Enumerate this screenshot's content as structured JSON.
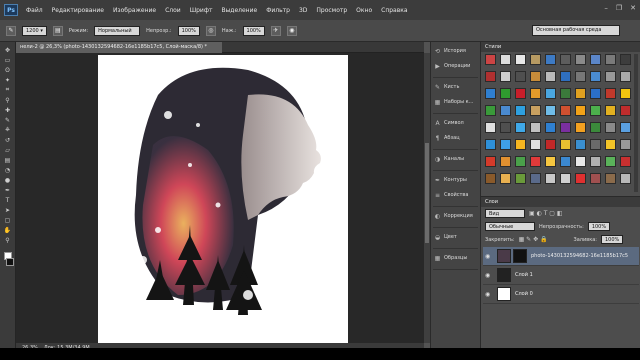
{
  "menubar": {
    "logo": "Ps",
    "items": [
      "Файл",
      "Редактирование",
      "Изображение",
      "Слои",
      "Шрифт",
      "Выделение",
      "Фильтр",
      "3D",
      "Просмотр",
      "Окно",
      "Справка"
    ],
    "window_controls": [
      "–",
      "❐",
      "✕"
    ]
  },
  "options": {
    "brush_size": "1200",
    "mode_label": "Режим:",
    "mode_value": "Нормальный",
    "opacity_label": "Непрозр.:",
    "opacity_value": "100%",
    "flow_label": "Наж.:",
    "flow_value": "100%",
    "workspace": "Основная рабочая среда"
  },
  "document": {
    "tab_title": "нели-2 @ 26,3% (photo-1430132594682-16e1185b17c5, Слой-маска/8) *",
    "zoom": "26,3%",
    "doc_size": "Док: 15,3M/34,9M"
  },
  "panel_column": {
    "groups": [
      [
        {
          "label": "История",
          "icon": "history-icon"
        },
        {
          "label": "Операции",
          "icon": "play-icon"
        }
      ],
      [
        {
          "label": "Кисть",
          "icon": "brush-icon"
        },
        {
          "label": "Наборы к...",
          "icon": "brush-presets-icon"
        }
      ],
      [
        {
          "label": "Символ",
          "icon": "character-icon"
        },
        {
          "label": "Абзац",
          "icon": "paragraph-icon"
        }
      ],
      [
        {
          "label": "Каналы",
          "icon": "channels-icon"
        }
      ],
      [
        {
          "label": "Контуры",
          "icon": "paths-icon"
        },
        {
          "label": "Свойства",
          "icon": "properties-icon"
        }
      ],
      [
        {
          "label": "Коррекция",
          "icon": "adjustments-icon"
        }
      ],
      [
        {
          "label": "Цвет",
          "icon": "color-icon"
        }
      ],
      [
        {
          "label": "Образцы",
          "icon": "swatches-icon"
        }
      ]
    ]
  },
  "styles_panel": {
    "title": "Стили",
    "swatch_colors": [
      "#c44",
      "#ddd",
      "#e8e8e8",
      "#b79a62",
      "#3d7ac4",
      "#5d5d5d",
      "#8a8a8a",
      "#5b86c9",
      "#7a7a7a",
      "#3d3d3d",
      "#b03030",
      "#cfcfcf",
      "#4f4f4f",
      "#c78c3a",
      "#bbb",
      "#2f6fbf",
      "#777",
      "#4a8bd0",
      "#999",
      "#aaa",
      "#2f7fd0",
      "#2f9a2f",
      "#c81e2a",
      "#e39a2a",
      "#4aa6e0",
      "#3b7a3b",
      "#e0a020",
      "#2b6fc8",
      "#c0392b",
      "#f1c40f",
      "#3a9a3a",
      "#4a8ad0",
      "#2ea0e0",
      "#c8a060",
      "#6fbce8",
      "#d05030",
      "#f2a218",
      "#4cb04c",
      "#e2b020",
      "#bf2c2c",
      "#e0e0e0",
      "#4f4f4f",
      "#3fa8e8",
      "#c0c0c0",
      "#2f80d0",
      "#7a2fa0",
      "#f2a020",
      "#3b8a3b",
      "#8a8a8a",
      "#5aa0e0",
      "#2e90d8",
      "#3ea0e8",
      "#f5b520",
      "#e0e0e0",
      "#c02828",
      "#e8c030",
      "#3a8fd0",
      "#6a6a6a",
      "#f2c428",
      "#9a9a9a",
      "#d43a2a",
      "#e09030",
      "#4aa04a",
      "#e03a3a",
      "#f6c640",
      "#3b88d0",
      "#e8e8e8",
      "#b0b0b0",
      "#5ab25a",
      "#c83030",
      "#8a5a2a",
      "#e8b050",
      "#6a9a3a",
      "#5a6a8a",
      "#c8c8c8",
      "#d0d0d0",
      "#e03030",
      "#a05050",
      "#8b6b4b",
      "#b8b8b8"
    ]
  },
  "layers_panel": {
    "title": "Слои",
    "filter_label": "Вид",
    "blend_mode": "Обычные",
    "opacity_label": "Непрозрачность:",
    "opacity_value": "100%",
    "lock_label": "Закрепить:",
    "fill_label": "Заливка:",
    "fill_value": "100%",
    "layers": [
      {
        "name": "photo-1430132594682-16e1185b17c5",
        "selected": true
      },
      {
        "name": "Слой 1",
        "selected": false
      },
      {
        "name": "Слой 0",
        "selected": false
      }
    ]
  },
  "tools": [
    "move-tool",
    "marquee-tool",
    "lasso-tool",
    "quick-select-tool",
    "crop-tool",
    "eyedropper-tool",
    "healing-tool",
    "brush-tool",
    "stamp-tool",
    "history-brush-tool",
    "eraser-tool",
    "gradient-tool",
    "blur-tool",
    "dodge-tool",
    "pen-tool",
    "type-tool",
    "path-select-tool",
    "shape-tool",
    "hand-tool",
    "zoom-tool"
  ]
}
